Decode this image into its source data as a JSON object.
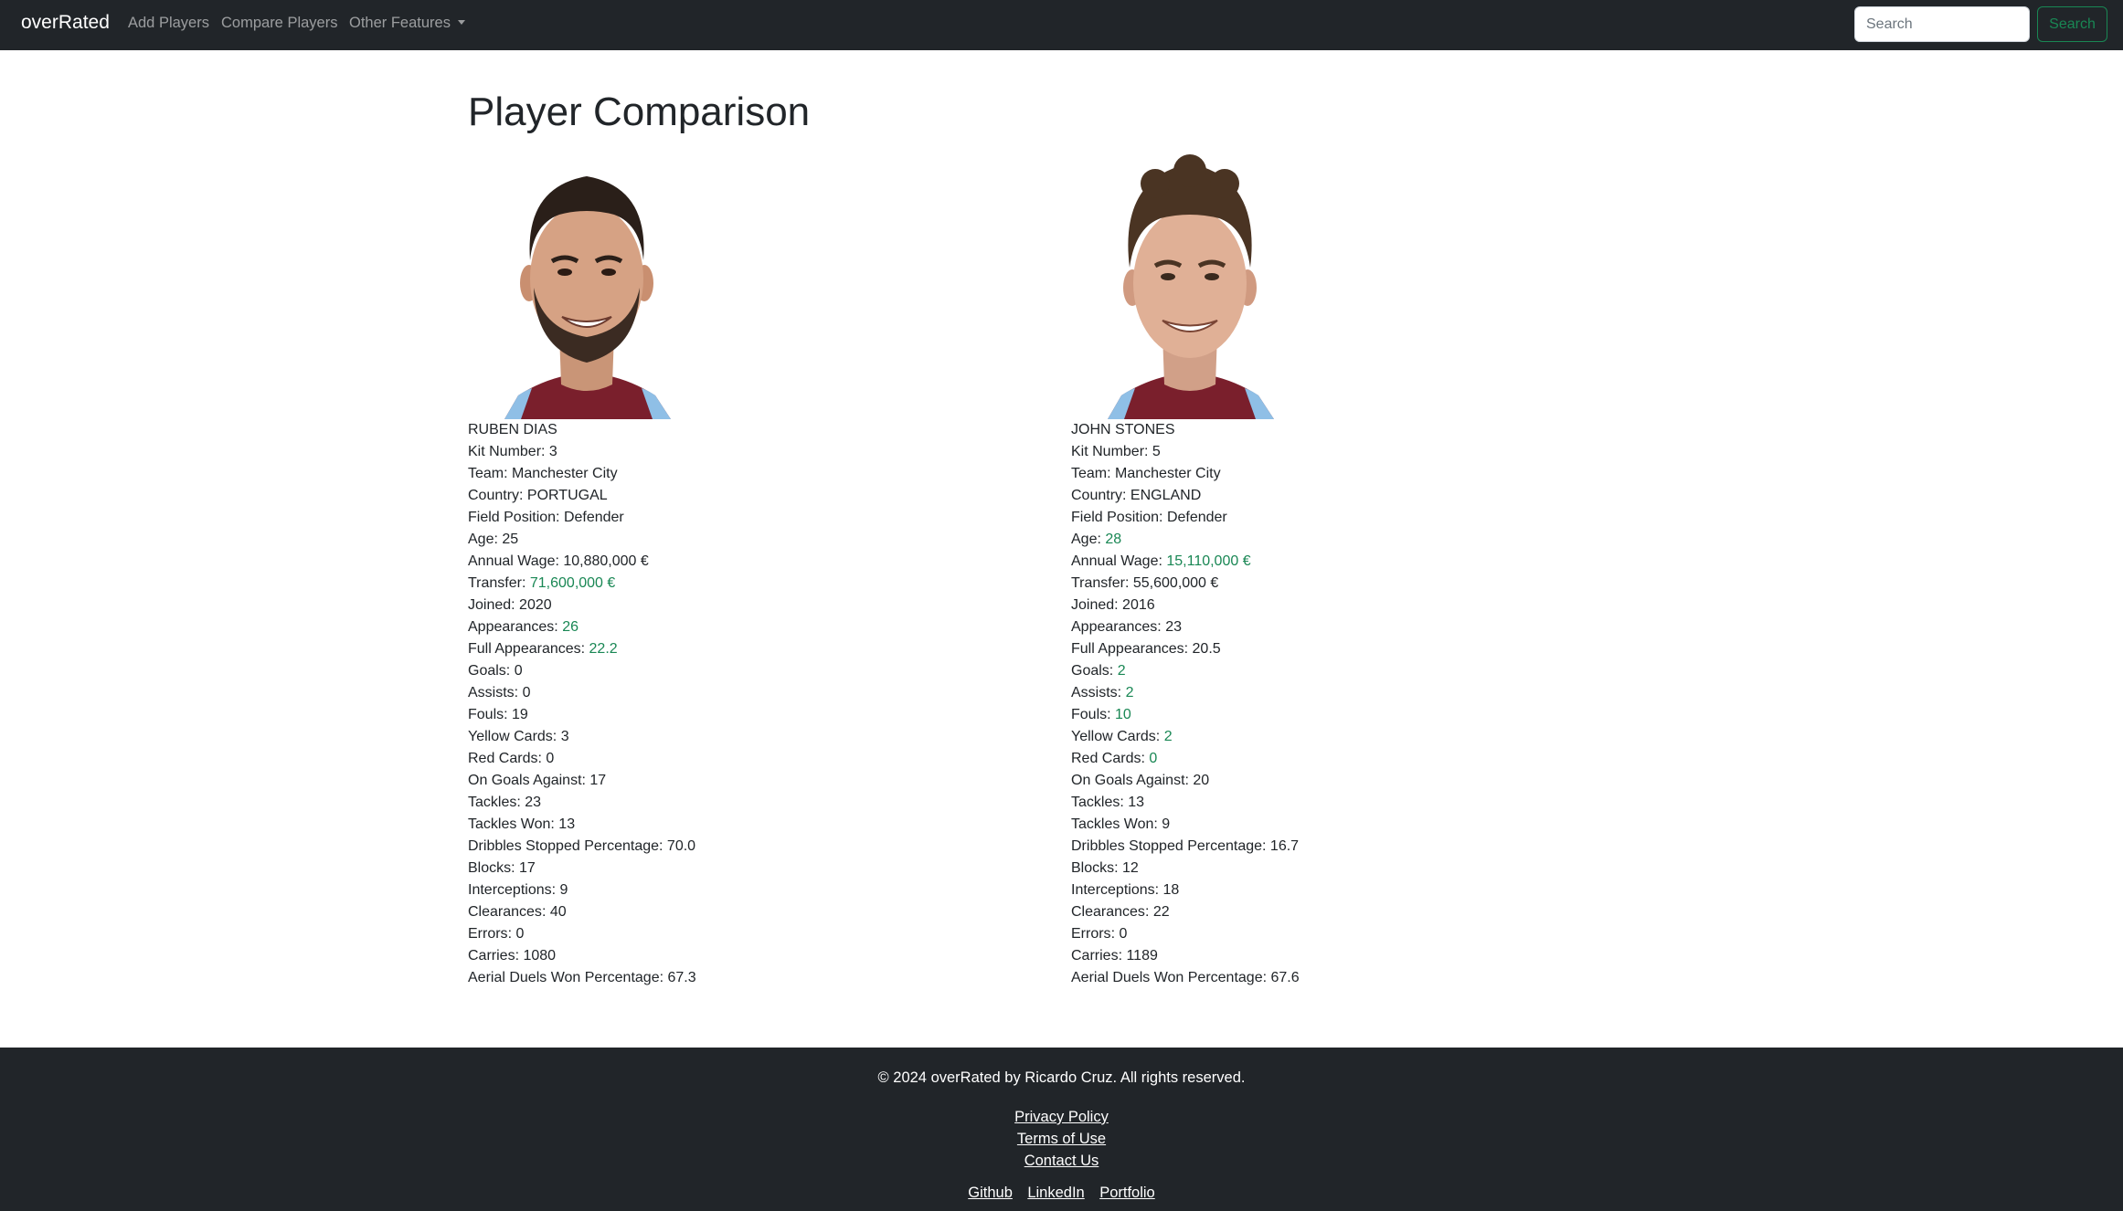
{
  "navbar": {
    "brand": "overRated",
    "links": [
      "Add Players",
      "Compare Players",
      "Other Features"
    ],
    "search_placeholder": "Search",
    "search_button": "Search",
    "accent_color": "#198754"
  },
  "main": {
    "title": "Player Comparison"
  },
  "players": [
    {
      "name": "RUBEN DIAS",
      "stats": [
        {
          "label": "Kit Number",
          "value": "3",
          "highlight": false
        },
        {
          "label": "Team",
          "value": "Manchester City",
          "highlight": false
        },
        {
          "label": "Country",
          "value": "PORTUGAL",
          "highlight": false
        },
        {
          "label": "Field Position",
          "value": "Defender",
          "highlight": false
        },
        {
          "label": "Age",
          "value": "25",
          "highlight": false
        },
        {
          "label": "Annual Wage",
          "value": "10,880,000 €",
          "highlight": false
        },
        {
          "label": "Transfer",
          "value": "71,600,000 €",
          "highlight": true
        },
        {
          "label": "Joined",
          "value": "2020",
          "highlight": false
        },
        {
          "label": "Appearances",
          "value": "26",
          "highlight": true
        },
        {
          "label": "Full Appearances",
          "value": "22.2",
          "highlight": true
        },
        {
          "label": "Goals",
          "value": "0",
          "highlight": false
        },
        {
          "label": "Assists",
          "value": "0",
          "highlight": false
        },
        {
          "label": "Fouls",
          "value": "19",
          "highlight": false
        },
        {
          "label": "Yellow Cards",
          "value": "3",
          "highlight": false
        },
        {
          "label": "Red Cards",
          "value": "0",
          "highlight": false
        },
        {
          "label": "On Goals Against",
          "value": "17",
          "highlight": false
        },
        {
          "label": "Tackles",
          "value": "23",
          "highlight": false
        },
        {
          "label": "Tackles Won",
          "value": "13",
          "highlight": false
        },
        {
          "label": "Dribbles Stopped Percentage",
          "value": "70.0",
          "highlight": false
        },
        {
          "label": "Blocks",
          "value": "17",
          "highlight": false
        },
        {
          "label": "Interceptions",
          "value": "9",
          "highlight": false
        },
        {
          "label": "Clearances",
          "value": "40",
          "highlight": false
        },
        {
          "label": "Errors",
          "value": "0",
          "highlight": false
        },
        {
          "label": "Carries",
          "value": "1080",
          "highlight": false
        },
        {
          "label": "Aerial Duels Won Percentage",
          "value": "67.3",
          "highlight": false
        }
      ]
    },
    {
      "name": "JOHN STONES",
      "stats": [
        {
          "label": "Kit Number",
          "value": "5",
          "highlight": false
        },
        {
          "label": "Team",
          "value": "Manchester City",
          "highlight": false
        },
        {
          "label": "Country",
          "value": "ENGLAND",
          "highlight": false
        },
        {
          "label": "Field Position",
          "value": "Defender",
          "highlight": false
        },
        {
          "label": "Age",
          "value": "28",
          "highlight": true
        },
        {
          "label": "Annual Wage",
          "value": "15,110,000 €",
          "highlight": true
        },
        {
          "label": "Transfer",
          "value": "55,600,000 €",
          "highlight": false
        },
        {
          "label": "Joined",
          "value": "2016",
          "highlight": false
        },
        {
          "label": "Appearances",
          "value": "23",
          "highlight": false
        },
        {
          "label": "Full Appearances",
          "value": "20.5",
          "highlight": false
        },
        {
          "label": "Goals",
          "value": "2",
          "highlight": true
        },
        {
          "label": "Assists",
          "value": "2",
          "highlight": true
        },
        {
          "label": "Fouls",
          "value": "10",
          "highlight": true
        },
        {
          "label": "Yellow Cards",
          "value": "2",
          "highlight": true
        },
        {
          "label": "Red Cards",
          "value": "0",
          "highlight": true
        },
        {
          "label": "On Goals Against",
          "value": "20",
          "highlight": false
        },
        {
          "label": "Tackles",
          "value": "13",
          "highlight": false
        },
        {
          "label": "Tackles Won",
          "value": "9",
          "highlight": false
        },
        {
          "label": "Dribbles Stopped Percentage",
          "value": "16.7",
          "highlight": false
        },
        {
          "label": "Blocks",
          "value": "12",
          "highlight": false
        },
        {
          "label": "Interceptions",
          "value": "18",
          "highlight": false
        },
        {
          "label": "Clearances",
          "value": "22",
          "highlight": false
        },
        {
          "label": "Errors",
          "value": "0",
          "highlight": false
        },
        {
          "label": "Carries",
          "value": "1189",
          "highlight": false
        },
        {
          "label": "Aerial Duels Won Percentage",
          "value": "67.6",
          "highlight": false
        }
      ]
    }
  ],
  "footer": {
    "copyright": "© 2024 overRated by Ricardo Cruz. All rights reserved.",
    "links": [
      "Privacy Policy",
      "Terms of Use",
      "Contact Us"
    ],
    "social": [
      "Github",
      "LinkedIn",
      "Portfolio"
    ]
  }
}
